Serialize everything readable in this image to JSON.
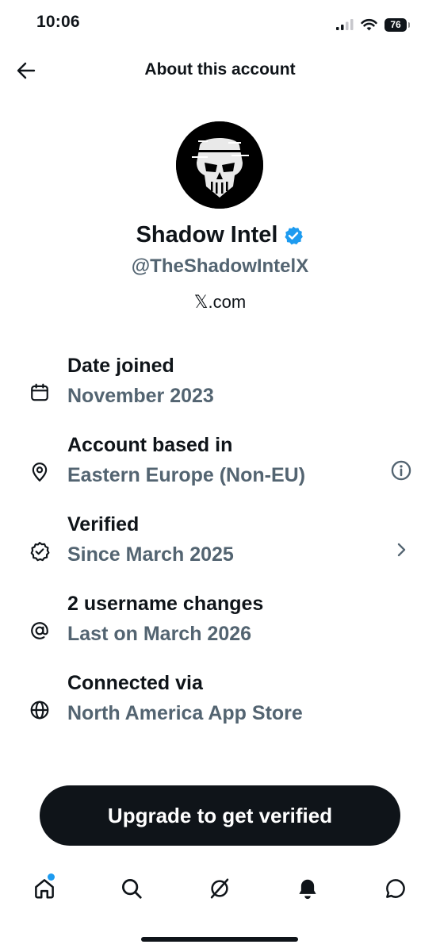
{
  "status": {
    "time": "10:06",
    "battery": "76"
  },
  "header": {
    "title": "About this account"
  },
  "profile": {
    "name": "Shadow Intel",
    "handle": "@TheShadowIntelX",
    "website": "𝕏.com"
  },
  "rows": [
    {
      "icon": "calendar-icon",
      "title": "Date joined",
      "sub": "November 2023"
    },
    {
      "icon": "location-pin-icon",
      "title": "Account based in",
      "sub": "Eastern Europe (Non-EU)",
      "action": "info-icon"
    },
    {
      "icon": "verified-badge-icon",
      "title": "Verified",
      "sub": "Since March 2025",
      "action": "chevron-right-icon"
    },
    {
      "icon": "at-sign-icon",
      "title": "2 username changes",
      "sub": "Last on March 2026"
    },
    {
      "icon": "globe-icon",
      "title": "Connected via",
      "sub": "North America App Store"
    }
  ],
  "cta": {
    "label": "Upgrade to get verified"
  },
  "tabs": [
    "home-icon",
    "search-icon",
    "grok-icon",
    "notifications-icon",
    "messages-icon"
  ],
  "colors": {
    "text": "#0f1419",
    "secondary": "#536471",
    "accent": "#1d9bf0"
  }
}
